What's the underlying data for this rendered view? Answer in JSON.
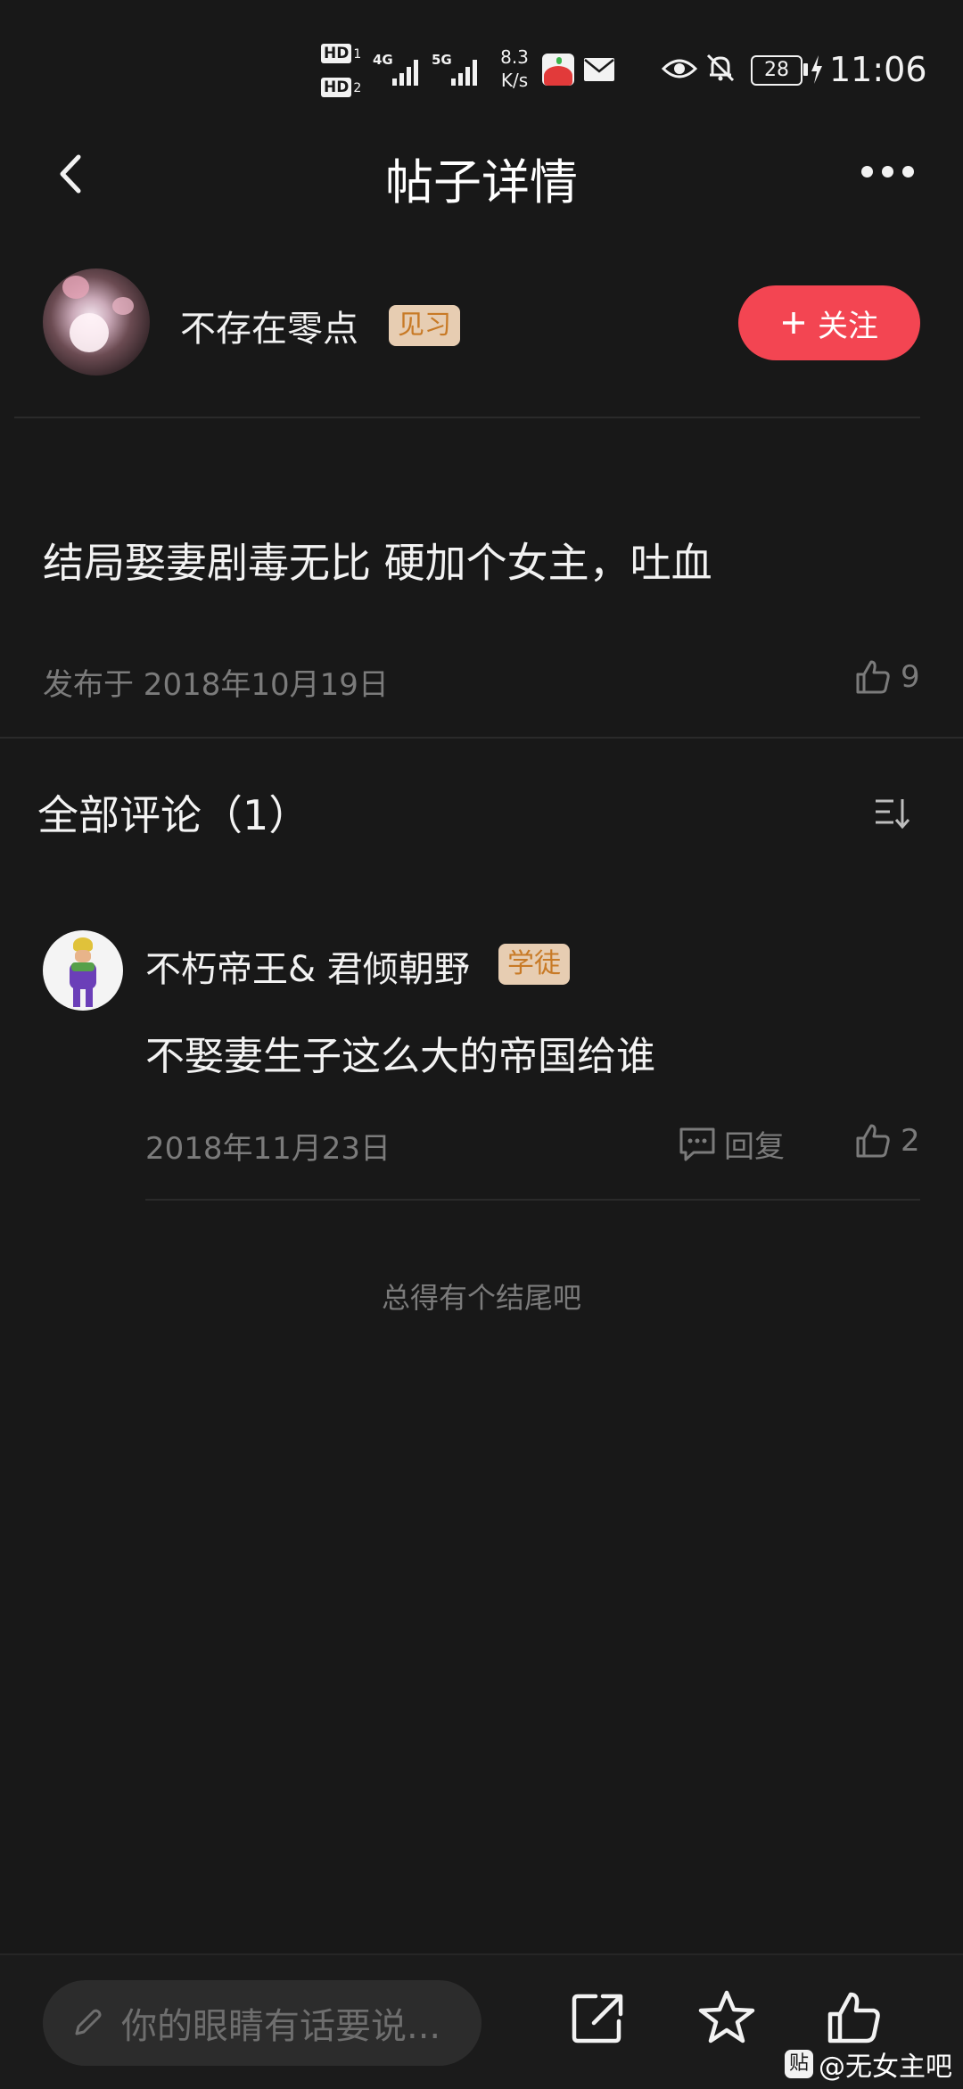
{
  "status_bar": {
    "hd1": "HD",
    "hd1_sub": "1",
    "hd2": "HD",
    "hd2_sub": "2",
    "net1": "4G",
    "net2": "5G",
    "speed_value": "8.3",
    "speed_unit": "K/s",
    "battery": "28",
    "time": "11:06"
  },
  "header": {
    "title": "帖子详情"
  },
  "post": {
    "author": "不存在零点",
    "author_badge": "见习",
    "follow_label": "关注",
    "content": "结局娶妻剧毒无比 硬加个女主，吐血",
    "published": "发布于 2018年10月19日",
    "likes": "9"
  },
  "comments": {
    "heading": "全部评论（1）",
    "items": [
      {
        "user": "不朽帝王& 君倾朝野",
        "badge": "学徒",
        "text": "不娶妻生子这么大的帝国给谁",
        "date": "2018年11月23日",
        "reply_label": "回复",
        "likes": "2"
      }
    ],
    "end_text": "总得有个结尾吧"
  },
  "bottom_bar": {
    "input_placeholder": "你的眼睛有话要说..."
  },
  "watermark": {
    "icon_text": "贴",
    "text": "@无女主吧"
  },
  "colors": {
    "background": "#181818",
    "follow_button": "#f34552",
    "badge_bg": "#e7cdb2",
    "badge_text": "#c87a26",
    "muted_text": "#7b7b7b"
  },
  "icons": [
    "back-icon",
    "more-icon",
    "plus-icon",
    "like-icon",
    "sort-icon",
    "reply-icon",
    "pencil-icon",
    "share-icon",
    "star-icon",
    "thumb-up-icon",
    "eye-icon",
    "bell-off-icon",
    "battery-icon",
    "charging-icon",
    "mail-icon"
  ]
}
